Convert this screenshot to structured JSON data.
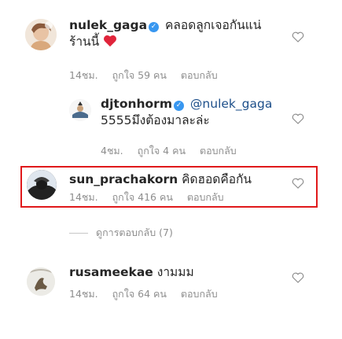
{
  "comments": [
    {
      "username": "nulek_gaga",
      "verified": true,
      "text_line1": "คลอดลูกเจอกันแน่",
      "text_line2": "ร้านนี้",
      "emoji": "red-heart",
      "time": "14ชม.",
      "likes": "ถูกใจ 59 คน",
      "reply": "ตอบกลับ"
    },
    {
      "username": "djtonhorm",
      "verified": true,
      "mention": "@nulek_gaga",
      "text_line2": "5555มึงต้องมาละล่ะ",
      "time": "4ชม.",
      "likes": "ถูกใจ 4 คน",
      "reply": "ตอบกลับ"
    },
    {
      "username": "sun_prachakorn",
      "verified": false,
      "text_line1": "คิดฮอดคือกัน",
      "time": "14ชม.",
      "likes": "ถูกใจ 416 คน",
      "reply": "ตอบกลับ",
      "highlight_color": "#e0191b"
    },
    {
      "username": "rusameekae",
      "verified": false,
      "text_line1": "งามมม",
      "time": "14ชม.",
      "likes": "ถูกใจ 64 คน",
      "reply": "ตอบกลับ"
    }
  ],
  "view_replies": "ดูการตอบกลับ (7)",
  "icons": {
    "like": "heart-outline-icon",
    "verified": "verified-badge-icon"
  },
  "colors": {
    "meta": "#8e8e8e",
    "verified": "#3897f0",
    "highlight": "#e0191b",
    "mention": "#1d4f8a"
  }
}
